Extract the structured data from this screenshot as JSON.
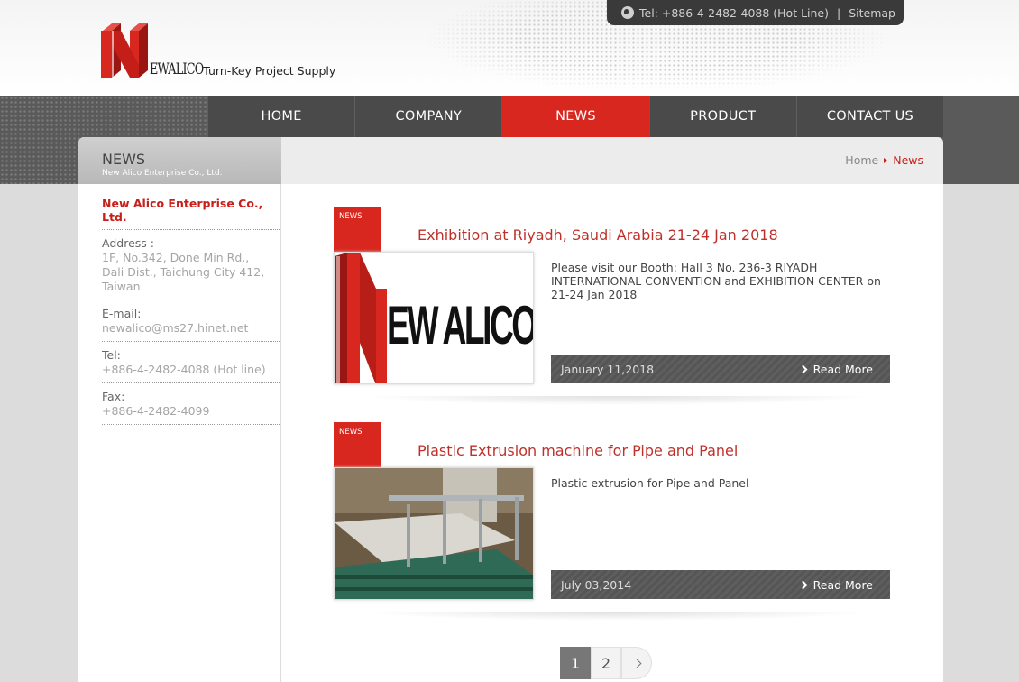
{
  "header": {
    "topbar": {
      "tel": "Tel: +886-4-2482-4088 (Hot Line)",
      "separator": "|",
      "sitemap": "Sitemap"
    },
    "logo": {
      "wordmark": "EWALICO",
      "tagline": "Turn-Key Project Supply"
    }
  },
  "nav": {
    "items": [
      {
        "label": "HOME"
      },
      {
        "label": "COMPANY"
      },
      {
        "label": "NEWS"
      },
      {
        "label": "PRODUCT"
      },
      {
        "label": "CONTACT US"
      }
    ],
    "active": "NEWS"
  },
  "page": {
    "title": "NEWS",
    "subtitle": "New Alico Enterprise Co., Ltd.",
    "breadcrumb": {
      "home": "Home",
      "current": "News"
    }
  },
  "sidebar": {
    "company": "New Alico Enterprise Co., Ltd.",
    "address_label": "Address :",
    "address_lines": [
      "1F, No.342, Done Min Rd.,",
      "Dali Dist., Taichung City 412,",
      "Taiwan"
    ],
    "email_label": "E-mail:",
    "email": "newalico@ms27.hinet.net",
    "tel_label": "Tel:",
    "tel": "+886-4-2482-4088 (Hot line)",
    "fax_label": "Fax:",
    "fax": "+886-4-2482-4099"
  },
  "news": [
    {
      "badge": "NEWS",
      "title": "Exhibition at Riyadh, Saudi Arabia 21-24 Jan 2018",
      "desc": "Please visit our Booth: Hall 3 No. 236-3 RIYADH INTERNATIONAL CONVENTION and EXHIBITION CENTER on 21-24 Jan 2018",
      "date": "January 11,2018",
      "more": "Read More",
      "thumb_text": "EW ALICO"
    },
    {
      "badge": "NEWS",
      "title": "Plastic Extrusion machine for Pipe and Panel",
      "desc": "Plastic extrusion for Pipe and Panel",
      "date": "July 03,2014",
      "more": "Read More"
    }
  ],
  "pagination": {
    "pages": [
      "1",
      "2"
    ],
    "current": "1"
  },
  "colors": {
    "brand_red": "#d8271f",
    "title_red": "#c0302a",
    "nav_bg": "#4a4a4a"
  }
}
